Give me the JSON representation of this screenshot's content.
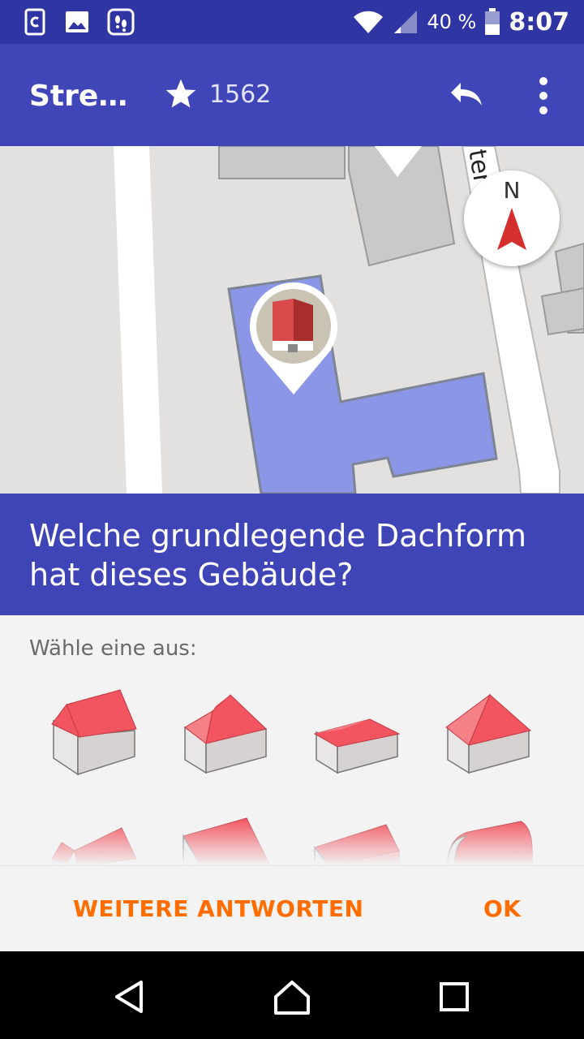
{
  "status_bar": {
    "left_icons": [
      "notification-app-icon",
      "image-icon",
      "footprint-icon"
    ],
    "battery_text": "40 %",
    "time": "8:07"
  },
  "toolbar": {
    "title": "Stre…",
    "star_count": "1562",
    "icons": [
      "star-icon",
      "undo-icon",
      "more-vert-icon"
    ]
  },
  "map": {
    "street_label_fragment": "ter",
    "compass_label": "N",
    "pin_icon": "roof-building-icon"
  },
  "question": {
    "text": "Welche grundlegende Dachform hat dieses Gebäude?"
  },
  "panel": {
    "hint": "Wähle eine aus:",
    "options": [
      "gabled-roof-icon",
      "hipped-roof-icon",
      "gabled-roof-alt-icon",
      "pyramidal-roof-icon",
      "gambrel-roof-icon",
      "skillion-roof-icon",
      "saltbox-roof-icon",
      "round-roof-icon"
    ]
  },
  "actions": {
    "more_answers": "WEITERE ANTWORTEN",
    "ok": "OK"
  },
  "colors": {
    "primary": "#4046b8",
    "primary_dark": "#3035a4",
    "accent": "#ff6d00",
    "roof_red": "#f2555f"
  },
  "nav_bar": [
    "back-icon",
    "home-icon",
    "recents-icon"
  ]
}
